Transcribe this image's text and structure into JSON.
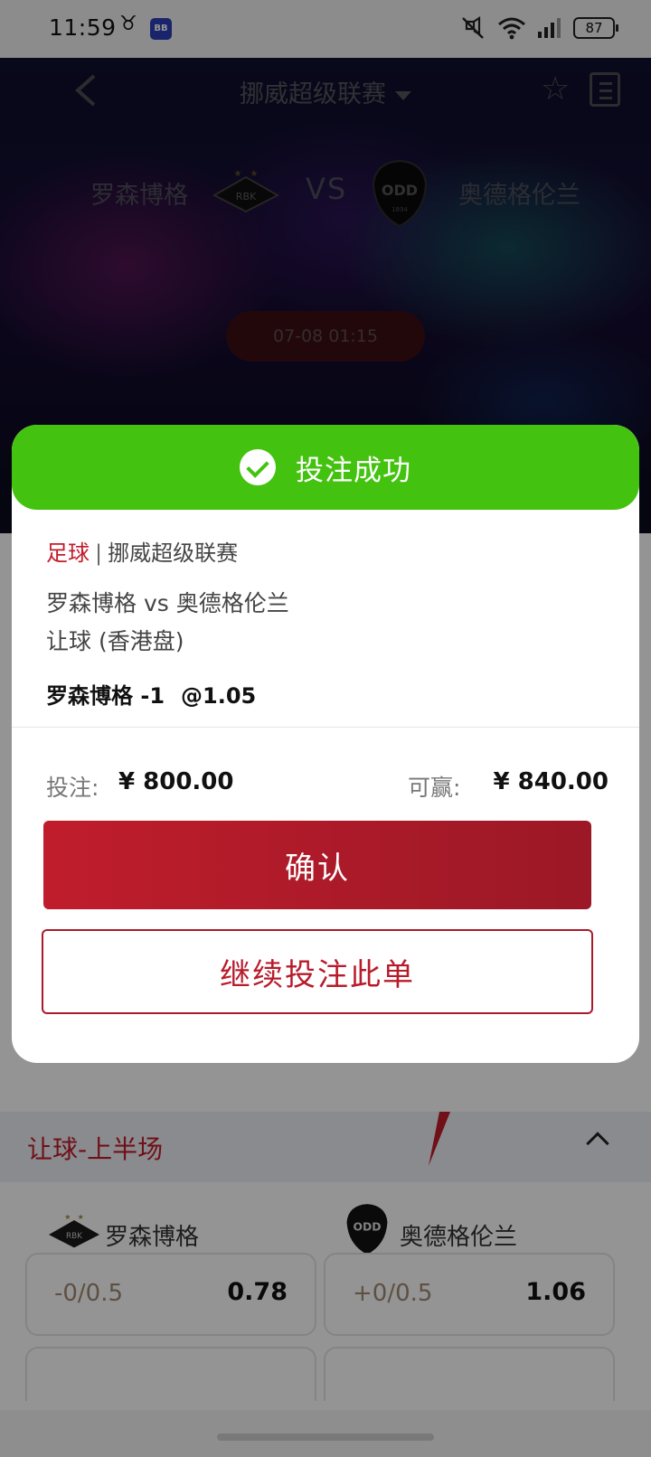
{
  "status_bar": {
    "time": "11:59",
    "taurus_glyph": "♉",
    "app_badge": "BB",
    "battery": "87",
    "icons": [
      "mute-vibrate-icon",
      "wifi-icon",
      "signal-icon",
      "battery-icon"
    ]
  },
  "header": {
    "league_title": "挪威超级联赛",
    "home_team": "罗森博格",
    "vs": "VS",
    "away_team": "奥德格伦兰",
    "home_logo_text": "RBK",
    "away_logo_text": "ODD",
    "away_logo_year": "1894",
    "kickoff": "07-08 01:15"
  },
  "background": {
    "section_title": "让球-上半场",
    "home_team": "罗森博格",
    "away_team": "奥德格伦兰",
    "home_line": "-0/0.5",
    "home_odds": "0.78",
    "away_line": "+0/0.5",
    "away_odds": "1.06"
  },
  "modal": {
    "title": "投注成功",
    "sport": "足球",
    "separator": "|",
    "league": "挪威超级联赛",
    "match": "罗森博格 vs 奥德格伦兰",
    "market": "让球 (香港盘)",
    "selection": "罗森博格 -1",
    "odds": "@1.05",
    "stake_label": "投注:",
    "stake_amount": "¥ 800.00",
    "win_label": "可赢:",
    "win_amount": "¥ 840.00",
    "confirm_label": "确认",
    "continue_label": "继续投注此单"
  },
  "colors": {
    "success_green": "#43c30f",
    "brand_red": "#c21c2b"
  }
}
